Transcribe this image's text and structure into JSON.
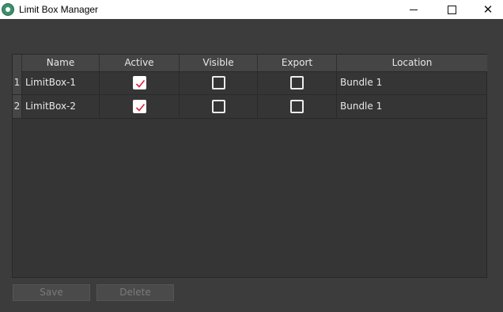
{
  "window": {
    "title": "Limit Box Manager"
  },
  "table": {
    "columns": [
      "Name",
      "Active",
      "Visible",
      "Export",
      "Location"
    ],
    "rows": [
      {
        "num": "1",
        "name": "LimitBox-1",
        "active": true,
        "visible": false,
        "export": false,
        "location": "Bundle 1"
      },
      {
        "num": "2",
        "name": "LimitBox-2",
        "active": true,
        "visible": false,
        "export": false,
        "location": "Bundle 1"
      }
    ]
  },
  "buttons": {
    "save": "Save",
    "delete": "Delete"
  },
  "colors": {
    "background": "#3c3c3c",
    "check": "#e0223c",
    "disabled_text": "#7a7a7a"
  }
}
